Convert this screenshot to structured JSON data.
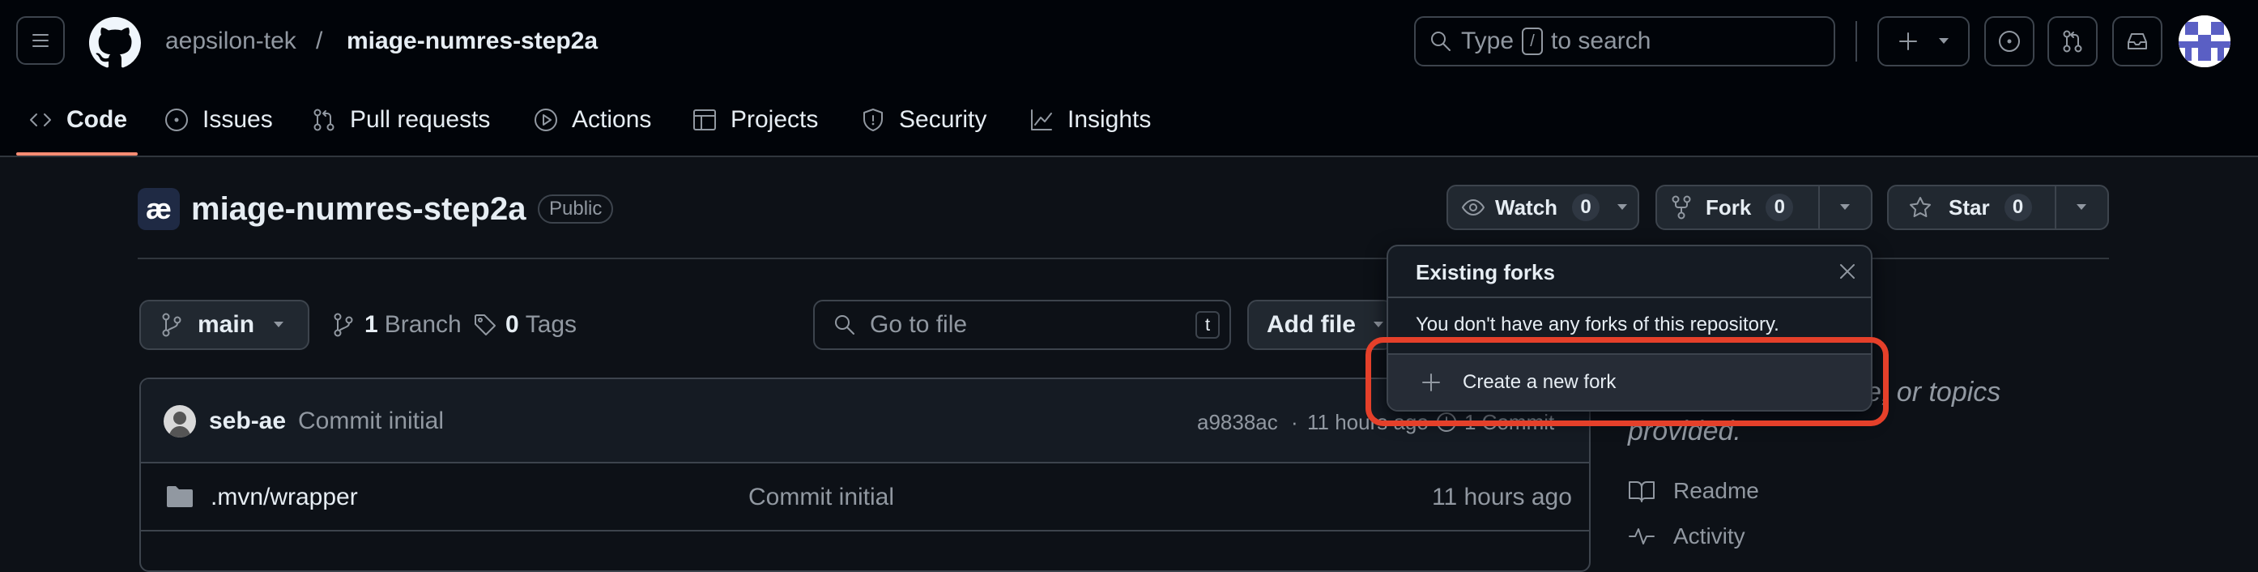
{
  "header": {
    "owner": "aepsilon-tek",
    "separator": "/",
    "repo": "miage-numres-step2a",
    "search": {
      "before": "Type",
      "key": "/",
      "after": "to search"
    }
  },
  "nav": {
    "code": "Code",
    "issues": "Issues",
    "pulls": "Pull requests",
    "actions": "Actions",
    "projects": "Projects",
    "security": "Security",
    "insights": "Insights"
  },
  "repo": {
    "avatar_text": "æ",
    "name": "miage-numres-step2a",
    "visibility": "Public",
    "watch_label": "Watch",
    "watch_count": "0",
    "fork_label": "Fork",
    "fork_count": "0",
    "star_label": "Star",
    "star_count": "0"
  },
  "toolbar": {
    "branch": "main",
    "branches_count": "1",
    "branches_label": "Branch",
    "tags_count": "0",
    "tags_label": "Tags",
    "goto_placeholder": "Go to file",
    "goto_key": "t",
    "add_file": "Add file"
  },
  "commit": {
    "author": "seb-ae",
    "message": "Commit initial",
    "hash": "a9838ac",
    "dot": "·",
    "time": "11 hours ago",
    "count_label": "1 Commit"
  },
  "files": [
    {
      "name": ".mvn/wrapper",
      "message": "Commit initial",
      "time": "11 hours ago"
    }
  ],
  "about": {
    "desc_visible": "site, or topics",
    "desc_line2": "provided.",
    "readme": "Readme",
    "activity": "Activity"
  },
  "forks_popup": {
    "title": "Existing forks",
    "message": "You don't have any forks of this repository.",
    "create": "Create a new fork"
  },
  "colors": {
    "nav_underline": "#fd8c73",
    "highlight": "#e5402a"
  }
}
